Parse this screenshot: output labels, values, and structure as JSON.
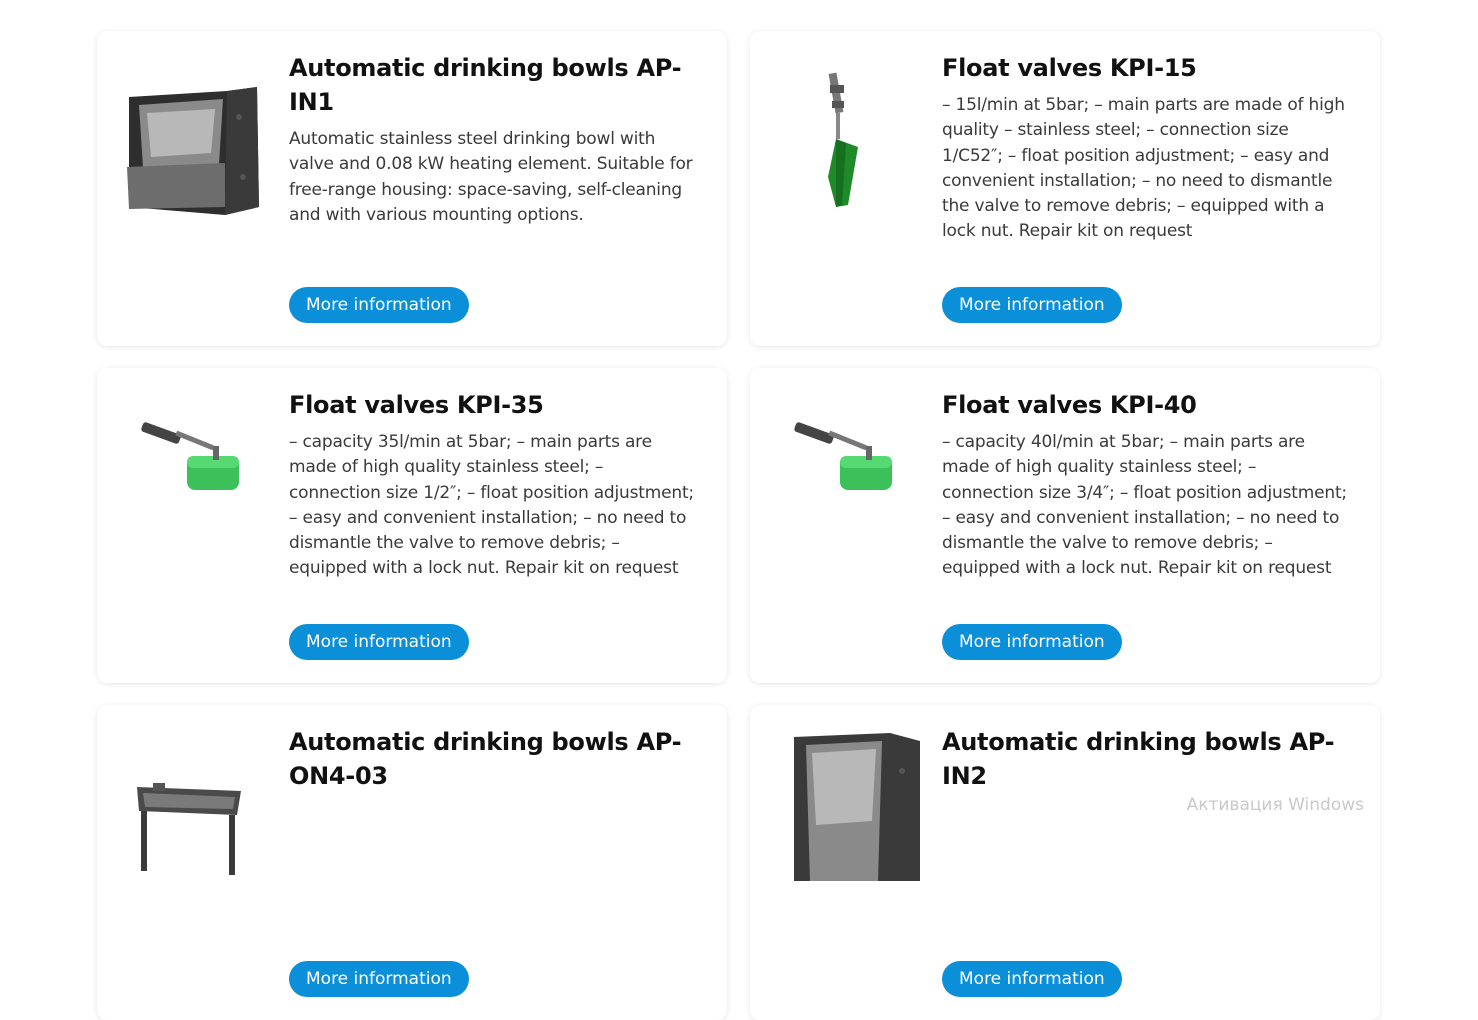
{
  "products": [
    {
      "title": "Automatic drinking bowls AP-IN1",
      "description": "Automatic stainless steel drinking bowl with valve and 0.08 kW heating element. Suitable for free-range housing: space-saving, self-cleaning and with various mounting options.",
      "button": "More information",
      "icon": "drinking-bowl-icon"
    },
    {
      "title": "Float valves KPI-15",
      "description": "– 15l/min at 5bar; – main parts are made of high quality – stainless steel; – connection size 1/C52″; – float position adjustment; – easy and convenient installation; – no need to dismantle the valve to remove debris; – equipped with a lock nut. Repair kit on request",
      "button": "More information",
      "icon": "float-valve-icon"
    },
    {
      "title": "Float valves KPI-35",
      "description": "– capacity 35l/min at 5bar; – main parts are made of high quality stainless steel; – connection size 1/2″; – float position adjustment; – easy and convenient installation; – no need to dismantle the valve to remove debris; – equipped with a lock nut. Repair kit on request",
      "button": "More information",
      "icon": "float-valve-icon"
    },
    {
      "title": "Float valves KPI-40",
      "description": "– capacity 40l/min at 5bar; – main parts are made of high quality stainless steel; – connection size 3/4″; – float position adjustment; – easy and convenient installation; – no need to dismantle the valve to remove debris; – equipped with a lock nut. Repair kit on request",
      "button": "More information",
      "icon": "float-valve-icon"
    },
    {
      "title": "Automatic drinking bowls AP-ON4-03",
      "description": "",
      "button": "More information",
      "icon": "trough-icon"
    },
    {
      "title": "Automatic drinking bowls AP-IN2",
      "description": "",
      "button": "More information",
      "icon": "drinking-bowl-icon"
    }
  ],
  "watermark": "Активация Windows",
  "colors": {
    "button": "#0a8fd8",
    "title": "#111111",
    "text": "#3a3a3a"
  }
}
